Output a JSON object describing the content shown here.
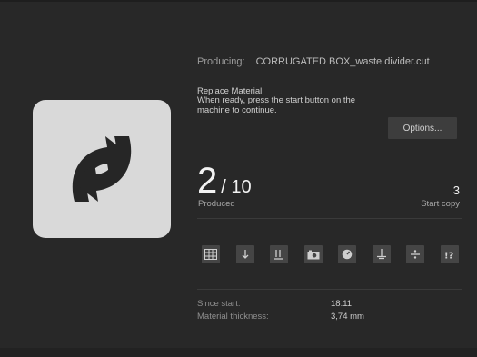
{
  "producing": {
    "label": "Producing:",
    "file": "CORRUGATED BOX_waste divider.cut"
  },
  "message": {
    "title": "Replace Material",
    "body": "When ready, press the start button on the machine to continue."
  },
  "options_label": "Options...",
  "counter": {
    "produced": "2",
    "total": "/ 10",
    "produced_label": "Produced"
  },
  "start_copy": {
    "value": "3",
    "label": "Start copy"
  },
  "toolbar_icons": [
    "grid-icon",
    "arrow-down-icon",
    "align-bottom-icon",
    "camera-icon",
    "gauge-icon",
    "ground-icon",
    "divide-icon",
    "help-icon"
  ],
  "stats": {
    "since_start_label": "Since start:",
    "since_start_value": "18:11",
    "thickness_label": "Material thickness:",
    "thickness_value": "3,74 mm"
  },
  "colors": {
    "background": "#282828",
    "tile": "#d9d9d9",
    "arrows": "#262626",
    "button": "#3d3d3d",
    "tool": "#454545"
  }
}
